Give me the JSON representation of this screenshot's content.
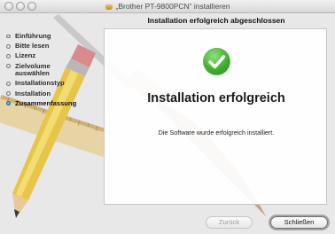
{
  "window": {
    "title": "„Brother PT-9800PCN“ installieren",
    "header": "Installation erfolgreich abgeschlossen"
  },
  "sidebar": {
    "steps": [
      {
        "label": "Einführung",
        "active": false
      },
      {
        "label": "Bitte lesen",
        "active": false
      },
      {
        "label": "Lizenz",
        "active": false
      },
      {
        "label": "Zielvolume auswählen",
        "active": false
      },
      {
        "label": "Installationstyp",
        "active": false
      },
      {
        "label": "Installation",
        "active": false
      },
      {
        "label": "Zusammenfassung",
        "active": true
      }
    ]
  },
  "main": {
    "success_icon": "checkmark-icon",
    "title": "Installation erfolgreich",
    "message": "Die Software wurde erfolgreich installiert."
  },
  "buttons": {
    "back": "Zurück",
    "close": "Schließen"
  },
  "colors": {
    "success_green": "#3fae2a",
    "active_step_blue": "#2b6fd1"
  }
}
